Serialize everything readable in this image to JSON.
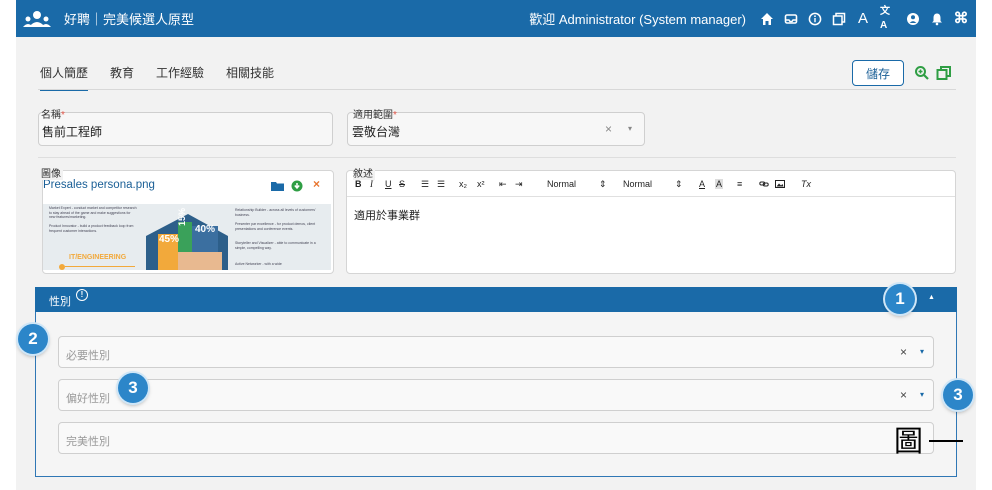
{
  "header": {
    "brand": "好聘｜完美候選人原型",
    "welcome": "歡迎 Administrator (System manager)",
    "icons": [
      "home-icon",
      "inbox-icon",
      "info-icon",
      "windows-icon",
      "font-icon",
      "translate-icon",
      "person-icon",
      "bell-icon",
      "command-icon"
    ],
    "font_glyph": "A",
    "translate_glyph": "文A",
    "command_glyph": "⌘",
    "bg_color": "#1a6aa8"
  },
  "tabs": [
    {
      "label": "個人簡歷",
      "active": true
    },
    {
      "label": "教育",
      "active": false
    },
    {
      "label": "工作經驗",
      "active": false
    },
    {
      "label": "相關技能",
      "active": false
    }
  ],
  "toolbar": {
    "save_label": "儲存"
  },
  "form": {
    "name": {
      "label": "名稱",
      "required": "*",
      "value": "售前工程師"
    },
    "scope": {
      "label": "適用範圍",
      "required": "*",
      "value": "雲敬台灣",
      "clear": "×",
      "caret": "▾"
    },
    "image": {
      "label": "圖像",
      "filename": "Presales persona.png",
      "actions": [
        "folder-icon",
        "download-icon",
        "remove-icon"
      ],
      "remove_glyph": "×",
      "preview": {
        "pct_a": "45%",
        "pct_b": "15%",
        "pct_c": "40%",
        "caption": "IT/ENGINEERING",
        "left_notes": [
          "Market Expert - conduct market and competitor research to stay ahead of the game and make suggestions for new features/marketing.",
          "Product Innovator - build a product feedback loop from frequent customer interactions."
        ],
        "right_notes": [
          "Relationship Builder - across all levels of customers' business.",
          "Presenter par excellence - for product demos, client presentations and conference events.",
          "Storyteller and Visualizer - able to communicate in a simple, compelling way.",
          "Active Networker - with a wide"
        ]
      }
    },
    "description": {
      "label": "敘述",
      "toolbar": {
        "bold": "B",
        "italic": "I",
        "underline": "U",
        "strike": "S",
        "ol": "☰",
        "ul": "☰",
        "sub": "x₂",
        "sup": "x²",
        "outdent": "⇤",
        "indent": "⇥",
        "style1": "Normal",
        "style2": "Normal",
        "color": "A",
        "bg": "A",
        "align": "≡",
        "link": "🔗",
        "image": "▣",
        "clear": "Tx"
      },
      "content": "適用於事業群"
    }
  },
  "gender_panel": {
    "title": "性別",
    "info_glyph": "!",
    "collapse": "▲",
    "selects": [
      {
        "placeholder": "必要性別",
        "clear": "×",
        "caret": "▾"
      },
      {
        "placeholder": "偏好性別",
        "clear": "×",
        "caret": "▾"
      },
      {
        "placeholder": "完美性別",
        "clear": "",
        "caret": ""
      }
    ]
  },
  "annotations": {
    "badges": [
      "1",
      "2",
      "3",
      "3"
    ],
    "callout_text": "圖"
  },
  "colors": {
    "accent": "#1a6aa8",
    "badge": "#2c86c9",
    "required": "#e4574a",
    "green": "#2f9e44",
    "orange": "#e8752f"
  }
}
